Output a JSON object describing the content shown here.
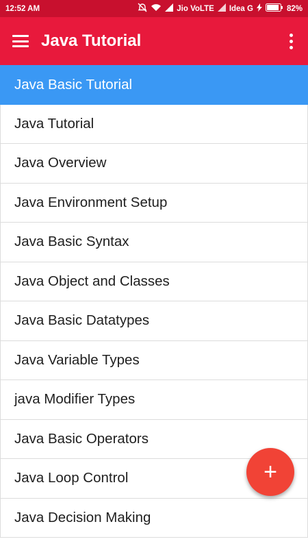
{
  "status_bar": {
    "time": "12:52 AM",
    "carrier1": "Jio VoLTE",
    "carrier2": "Idea G",
    "battery": "82%"
  },
  "app_bar": {
    "title": "Java Tutorial",
    "menu_icon": "hamburger-menu-icon",
    "overflow_icon": "more-vert-icon"
  },
  "list": {
    "items": [
      "Java Basic Tutorial",
      "Java Tutorial",
      "Java Overview",
      "Java Environment Setup",
      "Java Basic Syntax",
      "Java Object and Classes",
      "Java Basic Datatypes",
      "Java Variable Types",
      "java Modifier Types",
      "Java Basic Operators",
      "Java Loop Control",
      "Java Decision Making"
    ]
  },
  "fab": {
    "label": "+"
  },
  "colors": {
    "appbar": "#e8193c",
    "header_item": "#3a98f4",
    "fab": "#f14336"
  }
}
